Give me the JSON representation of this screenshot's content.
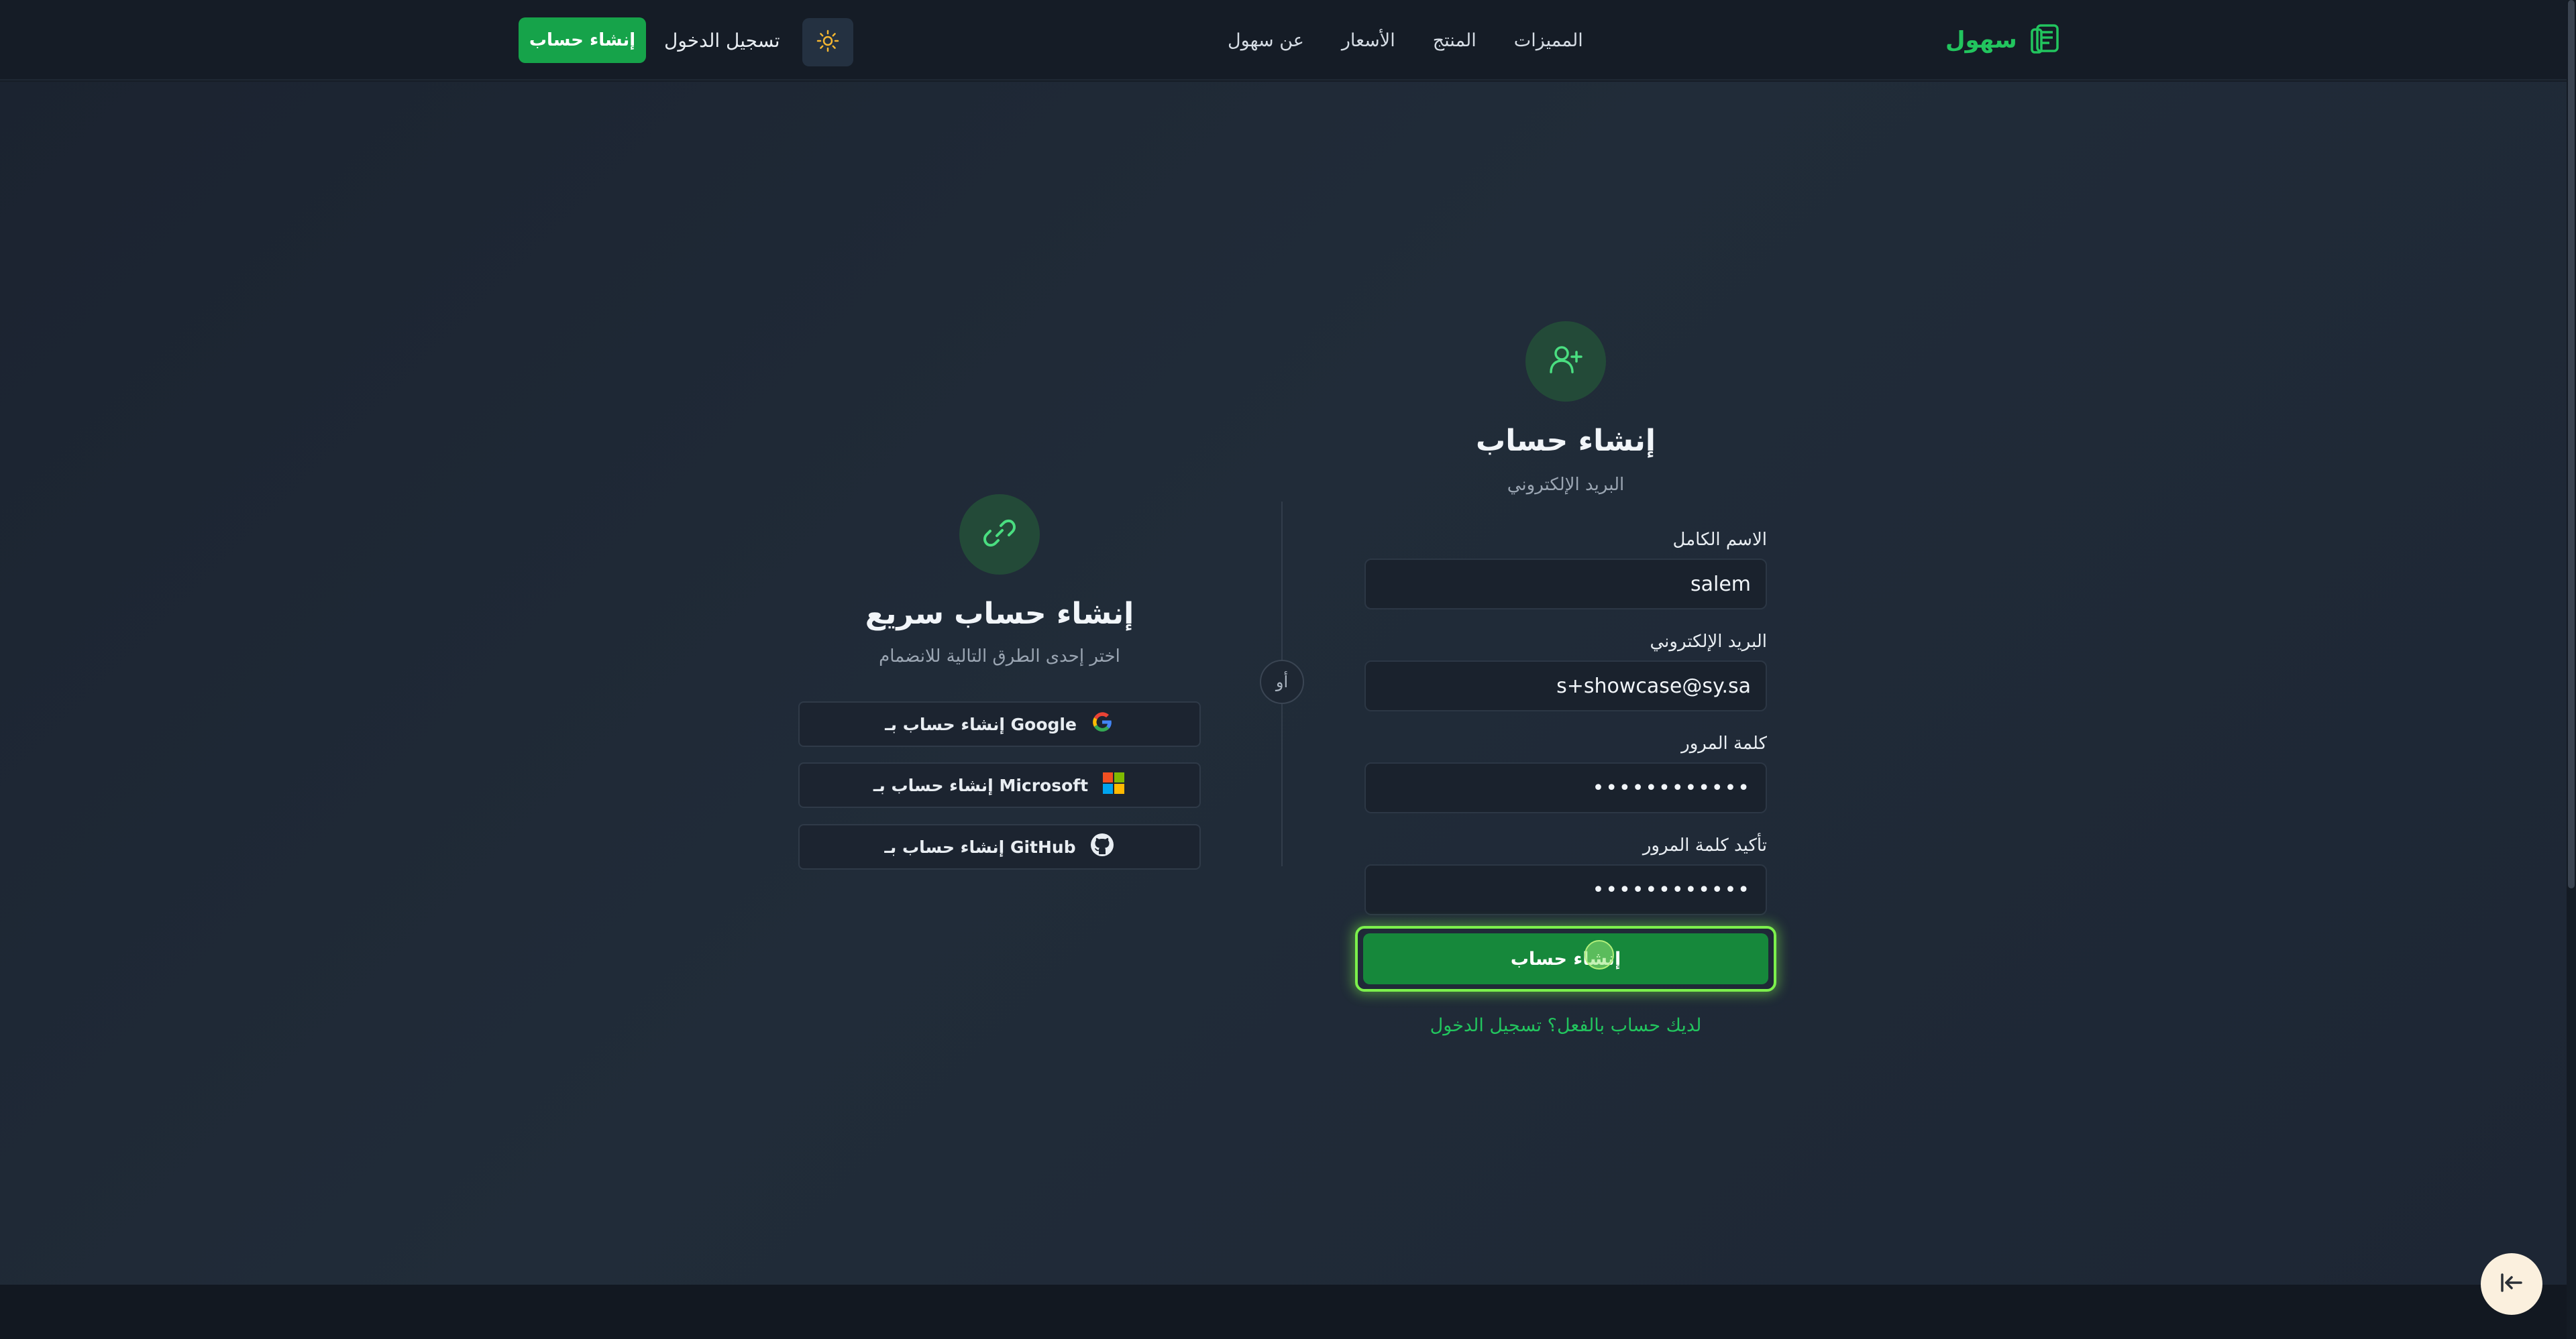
{
  "navbar": {
    "brand_name": "سهول",
    "links": [
      "المميزات",
      "المنتج",
      "الأسعار",
      "عن سهول"
    ],
    "login_label": "تسجيل الدخول",
    "signup_label": "إنشاء حساب"
  },
  "signup_form": {
    "title": "إنشاء حساب",
    "subtitle": "البريد الإلكتروني",
    "fields": {
      "full_name": {
        "label": "الاسم الكامل",
        "value": "salem"
      },
      "email": {
        "label": "البريد الإلكتروني",
        "value": "s+showcase@sy.sa"
      },
      "password": {
        "label": "كلمة المرور",
        "value": "••••••••••••"
      },
      "confirm_password": {
        "label": "تأكيد كلمة المرور",
        "value": "••••••••••••"
      }
    },
    "submit_label": "إنشاء حساب",
    "login_link": "لديك حساب بالفعل؟ تسجيل الدخول"
  },
  "divider": {
    "label": "أو"
  },
  "quick_signup": {
    "title": "إنشاء حساب سريع",
    "subtitle": "اختر إحدى الطرق التالية للانضمام",
    "providers": [
      {
        "label": "إنشاء حساب بـ Google",
        "icon": "google-icon"
      },
      {
        "label": "إنشاء حساب بـ Microsoft",
        "icon": "microsoft-icon"
      },
      {
        "label": "إنشاء حساب بـ GitHub",
        "icon": "github-icon"
      }
    ]
  },
  "colors": {
    "accent": "#22c55e",
    "primary_button": "#16a34a",
    "background": "#161d27"
  }
}
